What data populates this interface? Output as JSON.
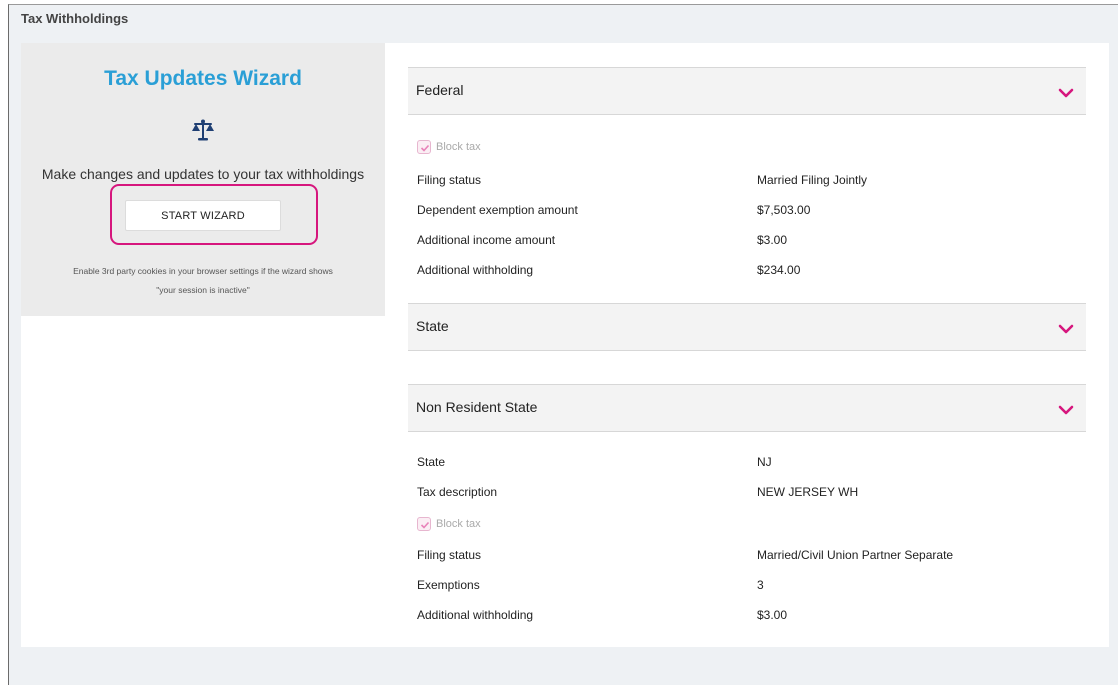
{
  "section": {
    "title": "Tax Withholdings"
  },
  "wizard": {
    "title": "Tax Updates Wizard",
    "icon": "scale-icon",
    "description": "Make changes and updates to your tax withholdings",
    "button_label": "START WIZARD",
    "note_line1": "Enable 3rd party cookies in your browser settings if the wizard shows",
    "note_line2": "\"your session is inactive\""
  },
  "federal": {
    "title": "Federal",
    "block_tax_label": "Block tax",
    "rows": [
      {
        "label": "Filing status",
        "value": "Married Filing Jointly"
      },
      {
        "label": "Dependent exemption amount",
        "value": "$7,503.00"
      },
      {
        "label": "Additional income amount",
        "value": "$3.00"
      },
      {
        "label": "Additional withholding",
        "value": "$234.00"
      }
    ]
  },
  "state": {
    "title": "State"
  },
  "non_resident": {
    "title": "Non Resident State",
    "rows_top": [
      {
        "label": "State",
        "value": "NJ"
      },
      {
        "label": "Tax description",
        "value": "NEW JERSEY WH"
      }
    ],
    "block_tax_label": "Block tax",
    "rows_bottom": [
      {
        "label": "Filing status",
        "value": "Married/Civil Union Partner Separate"
      },
      {
        "label": "Exemptions",
        "value": "3"
      },
      {
        "label": "Additional withholding",
        "value": "$3.00"
      }
    ]
  },
  "colors": {
    "accent": "#d6167d",
    "wizard_title": "#2a9fd6",
    "scale_icon": "#1f3f73"
  }
}
